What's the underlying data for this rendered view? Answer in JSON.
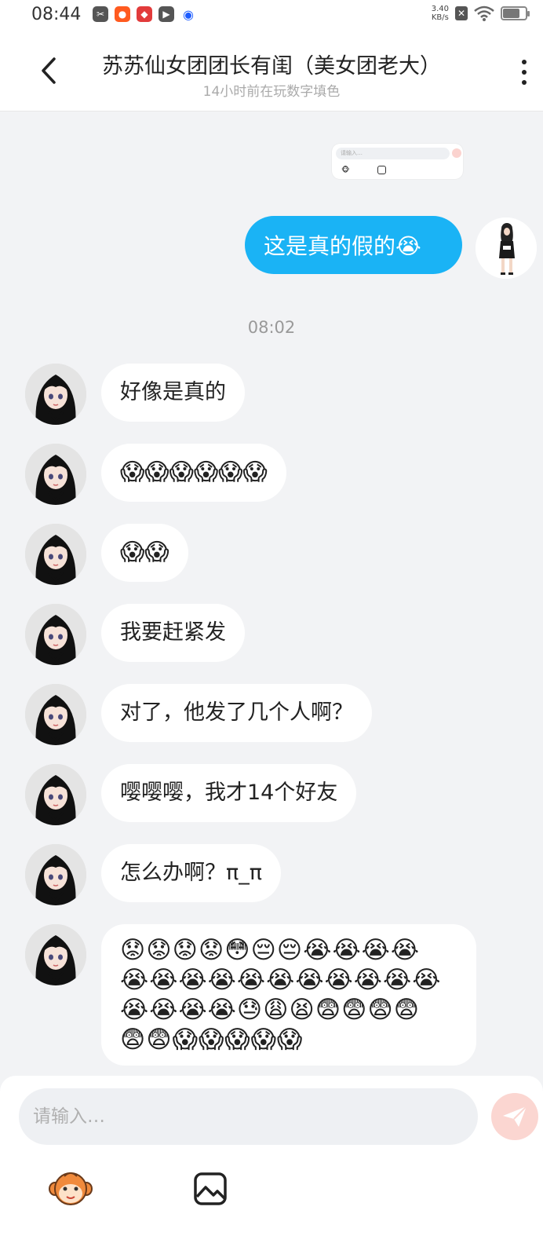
{
  "status_bar": {
    "time": "08:44",
    "net_speed_value": "3.40",
    "net_speed_unit": "KB/s",
    "battery_level": 0.7,
    "app_icons": [
      "scissors-app-icon",
      "kuaishou-app-icon",
      "game-app-icon",
      "video-play-app-icon",
      "blue-circle-app-icon"
    ]
  },
  "header": {
    "title": "苏苏仙女团团长有闺（美女团老大）",
    "subtitle": "14小时前在玩数字填色"
  },
  "chat": {
    "thumbnail": {
      "placeholder": "请输入…"
    },
    "outgoing": [
      {
        "text": "这是真的假的😭"
      }
    ],
    "timestamp": "08:02",
    "incoming": [
      {
        "text": "好像是真的"
      },
      {
        "text": "😱😱😱😱😱😱"
      },
      {
        "text": "😱😱"
      },
      {
        "text": "我要赶紧发"
      },
      {
        "text": "对了，他发了几个人啊？"
      },
      {
        "text": "嘤嘤嘤，我才14个好友"
      },
      {
        "text": "怎么办啊？π_π"
      },
      {
        "lines": [
          "😟😟😟😟😳😔😔😭😭😭😭",
          "😭😭😭😭😭😭😭😭😭😭😭",
          "😭😭😭😭😓😩😫😨😨😨😨",
          "😨😨😱😱😱😱😱"
        ]
      }
    ]
  },
  "input": {
    "placeholder": "请输入…"
  },
  "colors": {
    "outgoing_bubble": "#1ab3f5",
    "send_button": "#fbd6d1",
    "background": "#f2f3f5"
  }
}
